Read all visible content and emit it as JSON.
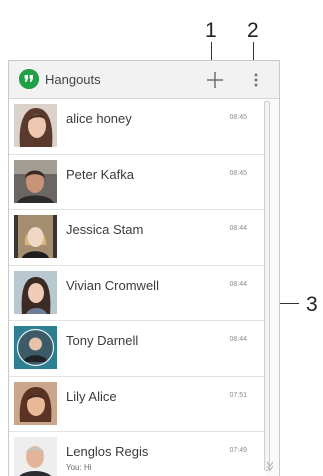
{
  "callouts": {
    "one": "1",
    "two": "2",
    "three": "3"
  },
  "app_bar": {
    "title": "Hangouts",
    "add_icon": "plus-icon",
    "menu_icon": "more-vert-icon",
    "logo_icon": "hangouts-logo-icon"
  },
  "conversations": [
    {
      "name": "alice honey",
      "time": "08:45",
      "snippet": ""
    },
    {
      "name": "Peter Kafka",
      "time": "08:45",
      "snippet": ""
    },
    {
      "name": "Jessica Stam",
      "time": "08:44",
      "snippet": ""
    },
    {
      "name": "Vivian Cromwell",
      "time": "08:44",
      "snippet": ""
    },
    {
      "name": "Tony Darnell",
      "time": "08:44",
      "snippet": ""
    },
    {
      "name": "Lily Alice",
      "time": "07:51",
      "snippet": ""
    },
    {
      "name": "Lenglos Regis",
      "time": "07:49",
      "snippet": "You: Hi"
    }
  ],
  "colors": {
    "hangouts_green": "#21a048",
    "callout_line": "#333333"
  }
}
